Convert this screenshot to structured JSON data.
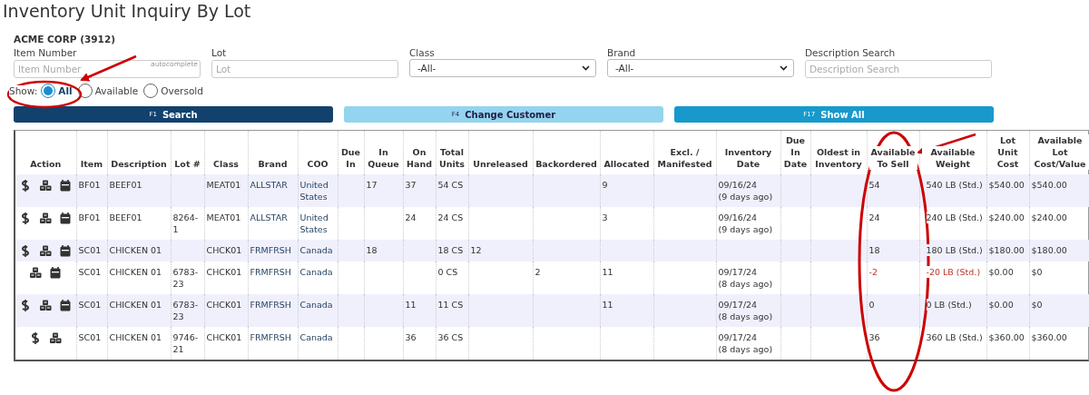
{
  "page_title": "Inventory Unit Inquiry By Lot",
  "customer": "ACME CORP (3912)",
  "filters": [
    {
      "kind": "text",
      "label": "Item Number",
      "placeholder": "Item Number",
      "hint": "autocomplete"
    },
    {
      "kind": "text",
      "label": "Lot",
      "placeholder": "Lot"
    },
    {
      "kind": "select",
      "label": "Class",
      "value": "-All-"
    },
    {
      "kind": "select",
      "label": "Brand",
      "value": "-All-"
    },
    {
      "kind": "text",
      "label": "Description Search",
      "placeholder": "Description Search"
    }
  ],
  "show": {
    "label": "Show:",
    "options": [
      {
        "label": "All",
        "selected": true
      },
      {
        "label": "Available",
        "selected": false
      },
      {
        "label": "Oversold",
        "selected": false
      }
    ]
  },
  "buttons": [
    {
      "key": "F1",
      "label": "Search",
      "kind": "primary"
    },
    {
      "key": "F4",
      "label": "Change Customer",
      "kind": "light"
    },
    {
      "key": "F17",
      "label": "Show All",
      "kind": "info"
    }
  ],
  "table": {
    "columns": [
      "Action",
      "Item",
      "Description",
      "Lot #",
      "Class",
      "Brand",
      "COO",
      "Due In",
      "In Queue",
      "On Hand",
      "Total Units",
      "Unreleased",
      "Backordered",
      "Allocated",
      "Excl. / Manifested",
      "Inventory Date",
      "Due In Date",
      "Oldest in Inventory",
      "Available To Sell",
      "Available Weight",
      "Lot Unit Cost",
      "Available Lot Cost/Value"
    ],
    "rows": [
      {
        "actions": [
          {
            "kind": "dollar"
          },
          {
            "kind": "boxes"
          },
          {
            "kind": "calendar"
          }
        ],
        "oversold": false,
        "cells": [
          "",
          "BF01",
          "BEEF01",
          null,
          "MEAT01",
          "ALLSTAR",
          "United States",
          null,
          "17",
          "37",
          "54 CS",
          null,
          null,
          "9",
          null,
          "09/16/24\n(9 days ago)",
          null,
          null,
          "54",
          "540 LB (Std.)",
          "$540.00",
          "$540.00"
        ]
      },
      {
        "actions": [
          {
            "kind": "dollar"
          },
          {
            "kind": "boxes"
          },
          {
            "kind": "calendar"
          }
        ],
        "oversold": false,
        "cells": [
          "",
          "BF01",
          "BEEF01",
          "8264-1",
          "MEAT01",
          "ALLSTAR",
          "United States",
          null,
          null,
          "24",
          "24 CS",
          null,
          null,
          "3",
          null,
          "09/16/24\n(9 days ago)",
          null,
          null,
          "24",
          "240 LB (Std.)",
          "$240.00",
          "$240.00"
        ]
      },
      {
        "actions": [
          {
            "kind": "dollar"
          },
          {
            "kind": "boxes"
          },
          {
            "kind": "calendar"
          }
        ],
        "oversold": false,
        "cells": [
          "",
          "SC01",
          "CHICKEN 01",
          null,
          "CHCK01",
          "FRMFRSH",
          "Canada",
          null,
          "18",
          null,
          "18 CS",
          "12",
          null,
          null,
          null,
          null,
          null,
          null,
          "18",
          "180 LB (Std.)",
          "$180.00",
          "$180.00"
        ]
      },
      {
        "actions": [
          {
            "kind": "boxes"
          },
          {
            "kind": "calendar"
          }
        ],
        "oversold": true,
        "cells": [
          "",
          "SC01",
          "CHICKEN 01",
          "6783-23",
          "CHCK01",
          "FRMFRSH",
          "Canada",
          null,
          null,
          null,
          "0 CS",
          null,
          "2",
          "11",
          null,
          "09/17/24\n(8 days ago)",
          null,
          null,
          "-2",
          "-20 LB (Std.)",
          "$0.00",
          "$0"
        ]
      },
      {
        "actions": [
          {
            "kind": "dollar"
          },
          {
            "kind": "boxes"
          },
          {
            "kind": "calendar"
          }
        ],
        "oversold": false,
        "cells": [
          "",
          "SC01",
          "CHICKEN 01",
          "6783-23",
          "CHCK01",
          "FRMFRSH",
          "Canada",
          null,
          null,
          "11",
          "11 CS",
          null,
          null,
          "11",
          null,
          "09/17/24\n(8 days ago)",
          null,
          null,
          "0",
          "0 LB (Std.)",
          "$0.00",
          "$0"
        ]
      },
      {
        "actions": [
          {
            "kind": "dollar"
          },
          {
            "kind": "boxes"
          }
        ],
        "oversold": false,
        "cells": [
          "",
          "SC01",
          "CHICKEN 01",
          "9746-21",
          "CHCK01",
          "FRMFRSH",
          "Canada",
          null,
          null,
          "36",
          "36 CS",
          null,
          null,
          null,
          null,
          "09/17/24\n(8 days ago)",
          null,
          null,
          "36",
          "360 LB (Std.)",
          "$360.00",
          "$360.00"
        ]
      }
    ]
  }
}
